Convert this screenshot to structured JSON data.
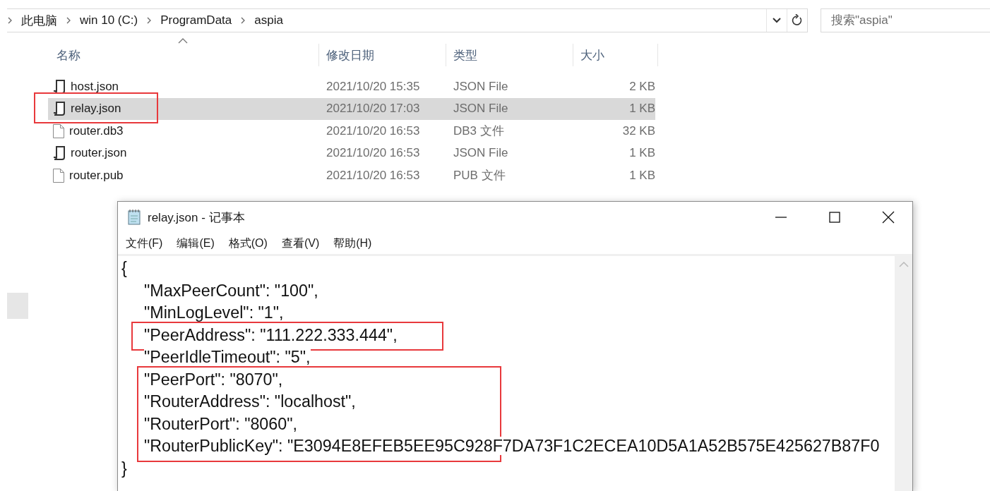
{
  "address_bar": {
    "breadcrumbs": [
      "此电脑",
      "win 10 (C:)",
      "ProgramData",
      "aspia"
    ]
  },
  "search": {
    "placeholder": "搜索\"aspia\""
  },
  "file_list": {
    "columns": [
      "名称",
      "修改日期",
      "类型",
      "大小"
    ],
    "rows": [
      {
        "name": "host.json",
        "date": "2021/10/20 15:35",
        "type": "JSON File",
        "size": "2 KB",
        "kind": "json",
        "selected": false,
        "highlighted": false
      },
      {
        "name": "relay.json",
        "date": "2021/10/20 17:03",
        "type": "JSON File",
        "size": "1 KB",
        "kind": "json",
        "selected": true,
        "highlighted": true
      },
      {
        "name": "router.db3",
        "date": "2021/10/20 16:53",
        "type": "DB3 文件",
        "size": "32 KB",
        "kind": "blank",
        "selected": false,
        "highlighted": false
      },
      {
        "name": "router.json",
        "date": "2021/10/20 16:53",
        "type": "JSON File",
        "size": "1 KB",
        "kind": "json",
        "selected": false,
        "highlighted": false
      },
      {
        "name": "router.pub",
        "date": "2021/10/20 16:53",
        "type": "PUB 文件",
        "size": "1 KB",
        "kind": "blank",
        "selected": false,
        "highlighted": false
      }
    ]
  },
  "notepad": {
    "title": "relay.json - 记事本",
    "menu": [
      "文件(F)",
      "编辑(E)",
      "格式(O)",
      "查看(V)",
      "帮助(H)"
    ],
    "blocks": [
      {
        "highlighted": false,
        "lines": [
          {
            "kind": "brace",
            "text": "{"
          },
          {
            "kind": "entry",
            "text": "\"MaxPeerCount\": \"100\","
          },
          {
            "kind": "entry",
            "text": "\"MinLogLevel\": \"1\","
          }
        ]
      },
      {
        "highlighted": true,
        "lines": [
          {
            "kind": "entry",
            "text": "\"PeerAddress\": \"111.222.333.444\","
          }
        ]
      },
      {
        "highlighted": false,
        "lines": [
          {
            "kind": "entry",
            "text": "\"PeerIdleTimeout\": \"5\","
          }
        ]
      },
      {
        "highlighted": true,
        "lines": [
          {
            "kind": "entry",
            "text": "\"PeerPort\": \"8070\","
          },
          {
            "kind": "entry",
            "text": "\"RouterAddress\": \"localhost\","
          },
          {
            "kind": "entry",
            "text": "\"RouterPort\": \"8060\","
          },
          {
            "kind": "entry",
            "text": "\"RouterPublicKey\": \"E3094E8EFEB5EE95C928F7DA73F1C2ECEA10D5A1A52B575E425627B87F0"
          }
        ]
      },
      {
        "highlighted": false,
        "lines": [
          {
            "kind": "brace",
            "text": "}"
          }
        ]
      }
    ]
  }
}
